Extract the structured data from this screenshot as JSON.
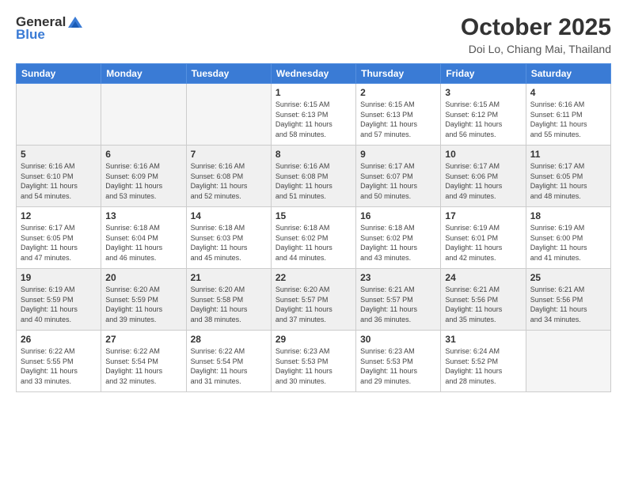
{
  "header": {
    "logo_general": "General",
    "logo_blue": "Blue",
    "month_title": "October 2025",
    "location": "Doi Lo, Chiang Mai, Thailand"
  },
  "days_of_week": [
    "Sunday",
    "Monday",
    "Tuesday",
    "Wednesday",
    "Thursday",
    "Friday",
    "Saturday"
  ],
  "weeks": [
    [
      {
        "day": "",
        "info": ""
      },
      {
        "day": "",
        "info": ""
      },
      {
        "day": "",
        "info": ""
      },
      {
        "day": "1",
        "info": "Sunrise: 6:15 AM\nSunset: 6:13 PM\nDaylight: 11 hours\nand 58 minutes."
      },
      {
        "day": "2",
        "info": "Sunrise: 6:15 AM\nSunset: 6:13 PM\nDaylight: 11 hours\nand 57 minutes."
      },
      {
        "day": "3",
        "info": "Sunrise: 6:15 AM\nSunset: 6:12 PM\nDaylight: 11 hours\nand 56 minutes."
      },
      {
        "day": "4",
        "info": "Sunrise: 6:16 AM\nSunset: 6:11 PM\nDaylight: 11 hours\nand 55 minutes."
      }
    ],
    [
      {
        "day": "5",
        "info": "Sunrise: 6:16 AM\nSunset: 6:10 PM\nDaylight: 11 hours\nand 54 minutes."
      },
      {
        "day": "6",
        "info": "Sunrise: 6:16 AM\nSunset: 6:09 PM\nDaylight: 11 hours\nand 53 minutes."
      },
      {
        "day": "7",
        "info": "Sunrise: 6:16 AM\nSunset: 6:08 PM\nDaylight: 11 hours\nand 52 minutes."
      },
      {
        "day": "8",
        "info": "Sunrise: 6:16 AM\nSunset: 6:08 PM\nDaylight: 11 hours\nand 51 minutes."
      },
      {
        "day": "9",
        "info": "Sunrise: 6:17 AM\nSunset: 6:07 PM\nDaylight: 11 hours\nand 50 minutes."
      },
      {
        "day": "10",
        "info": "Sunrise: 6:17 AM\nSunset: 6:06 PM\nDaylight: 11 hours\nand 49 minutes."
      },
      {
        "day": "11",
        "info": "Sunrise: 6:17 AM\nSunset: 6:05 PM\nDaylight: 11 hours\nand 48 minutes."
      }
    ],
    [
      {
        "day": "12",
        "info": "Sunrise: 6:17 AM\nSunset: 6:05 PM\nDaylight: 11 hours\nand 47 minutes."
      },
      {
        "day": "13",
        "info": "Sunrise: 6:18 AM\nSunset: 6:04 PM\nDaylight: 11 hours\nand 46 minutes."
      },
      {
        "day": "14",
        "info": "Sunrise: 6:18 AM\nSunset: 6:03 PM\nDaylight: 11 hours\nand 45 minutes."
      },
      {
        "day": "15",
        "info": "Sunrise: 6:18 AM\nSunset: 6:02 PM\nDaylight: 11 hours\nand 44 minutes."
      },
      {
        "day": "16",
        "info": "Sunrise: 6:18 AM\nSunset: 6:02 PM\nDaylight: 11 hours\nand 43 minutes."
      },
      {
        "day": "17",
        "info": "Sunrise: 6:19 AM\nSunset: 6:01 PM\nDaylight: 11 hours\nand 42 minutes."
      },
      {
        "day": "18",
        "info": "Sunrise: 6:19 AM\nSunset: 6:00 PM\nDaylight: 11 hours\nand 41 minutes."
      }
    ],
    [
      {
        "day": "19",
        "info": "Sunrise: 6:19 AM\nSunset: 5:59 PM\nDaylight: 11 hours\nand 40 minutes."
      },
      {
        "day": "20",
        "info": "Sunrise: 6:20 AM\nSunset: 5:59 PM\nDaylight: 11 hours\nand 39 minutes."
      },
      {
        "day": "21",
        "info": "Sunrise: 6:20 AM\nSunset: 5:58 PM\nDaylight: 11 hours\nand 38 minutes."
      },
      {
        "day": "22",
        "info": "Sunrise: 6:20 AM\nSunset: 5:57 PM\nDaylight: 11 hours\nand 37 minutes."
      },
      {
        "day": "23",
        "info": "Sunrise: 6:21 AM\nSunset: 5:57 PM\nDaylight: 11 hours\nand 36 minutes."
      },
      {
        "day": "24",
        "info": "Sunrise: 6:21 AM\nSunset: 5:56 PM\nDaylight: 11 hours\nand 35 minutes."
      },
      {
        "day": "25",
        "info": "Sunrise: 6:21 AM\nSunset: 5:56 PM\nDaylight: 11 hours\nand 34 minutes."
      }
    ],
    [
      {
        "day": "26",
        "info": "Sunrise: 6:22 AM\nSunset: 5:55 PM\nDaylight: 11 hours\nand 33 minutes."
      },
      {
        "day": "27",
        "info": "Sunrise: 6:22 AM\nSunset: 5:54 PM\nDaylight: 11 hours\nand 32 minutes."
      },
      {
        "day": "28",
        "info": "Sunrise: 6:22 AM\nSunset: 5:54 PM\nDaylight: 11 hours\nand 31 minutes."
      },
      {
        "day": "29",
        "info": "Sunrise: 6:23 AM\nSunset: 5:53 PM\nDaylight: 11 hours\nand 30 minutes."
      },
      {
        "day": "30",
        "info": "Sunrise: 6:23 AM\nSunset: 5:53 PM\nDaylight: 11 hours\nand 29 minutes."
      },
      {
        "day": "31",
        "info": "Sunrise: 6:24 AM\nSunset: 5:52 PM\nDaylight: 11 hours\nand 28 minutes."
      },
      {
        "day": "",
        "info": ""
      }
    ]
  ]
}
